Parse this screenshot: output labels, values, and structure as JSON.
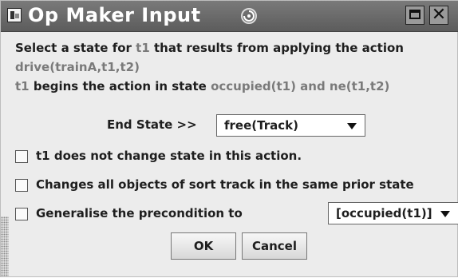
{
  "window": {
    "title": "Op Maker Input"
  },
  "instructions": {
    "line1_prefix": "Select a state for ",
    "line1_var": "t1",
    "line1_suffix": " that results from applying the action",
    "line2_action": "drive(trainA,t1,t2)",
    "line3_var": "t1",
    "line3_middle": " begins the action in state ",
    "line3_state": "occupied(t1) and ne(t1,t2)"
  },
  "end_state": {
    "label": "End State >>",
    "selected": "free(Track)"
  },
  "options": {
    "no_change_label": "t1 does not change state in this action.",
    "change_all_label": "Changes all objects of sort track in the same prior state",
    "generalise_label": "Generalise the precondition to",
    "generalise_selected": "[occupied(t1)]"
  },
  "buttons": {
    "ok_label": "OK",
    "cancel_label": "Cancel"
  },
  "colors": {
    "title_bar": "#6b6b6b",
    "highlight_text": "#7a7a7a",
    "body_text": "#1e1e1e",
    "background": "#ececec"
  },
  "icons": [
    "app-icon",
    "swirl-icon",
    "maximize-icon",
    "close-icon",
    "dropdown-arrow-icon",
    "resize-grip-icon"
  ]
}
